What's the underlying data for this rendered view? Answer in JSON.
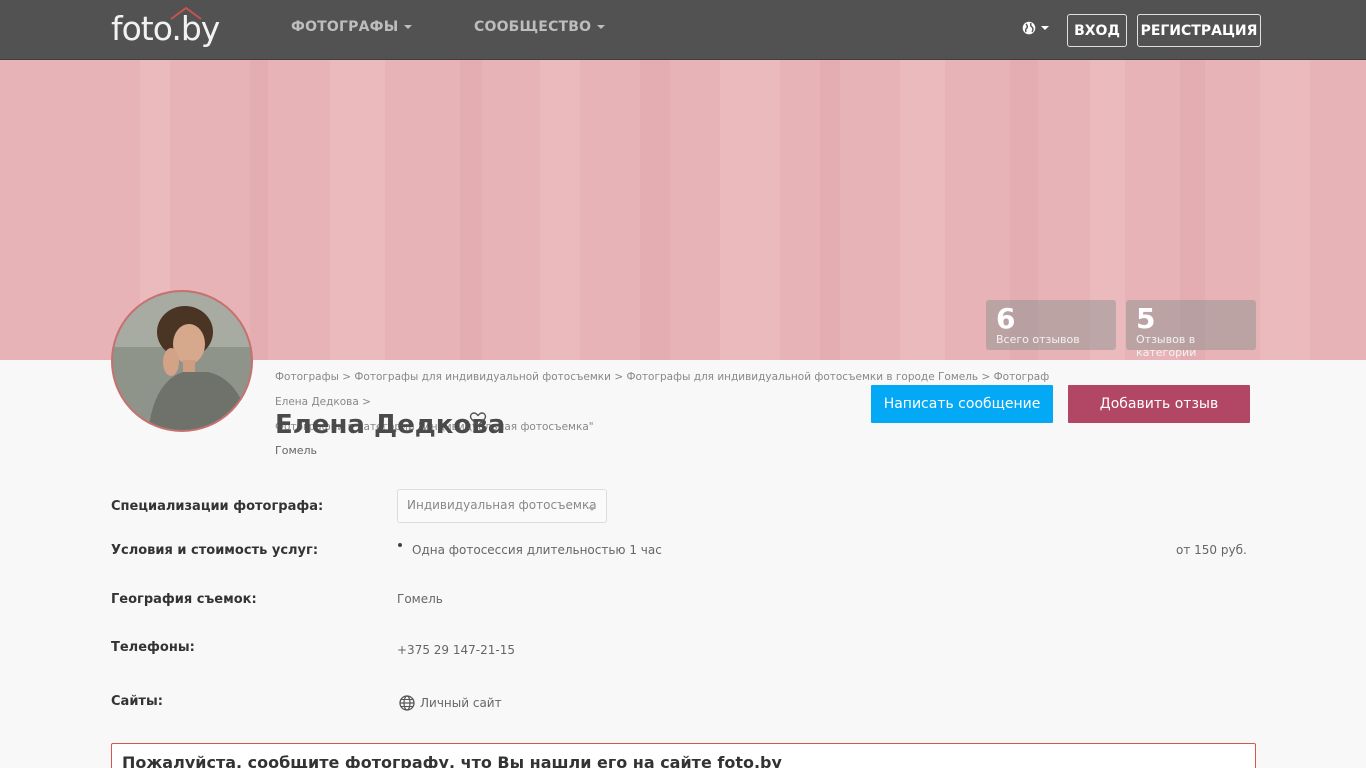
{
  "header": {
    "logo": "foto.by",
    "nav": [
      {
        "label": "ФОТОГРАФЫ"
      },
      {
        "label": "СООБЩЕСТВО"
      }
    ],
    "language_icon": "globe-icon",
    "login_label": "ВХОД",
    "register_label": "РЕГИСТРАЦИЯ"
  },
  "stats": [
    {
      "value": "6",
      "label": "Всего отзывов"
    },
    {
      "value": "5",
      "label": "Отзывов в категории"
    }
  ],
  "breadcrumbs": [
    "Фотографы",
    "Фотографы для индивидуальной фотосъемки",
    "Фотографы для индивидуальной фотосъемки в городе Гомель",
    "Фотограф Елена Дедкова",
    "Фотографии в категории \"Индивидуальная фотосъемка\""
  ],
  "breadcrumb_separator": ">",
  "profile": {
    "name": "Елена Дедкова",
    "city": "Гомель"
  },
  "actions": {
    "message_label": "Написать сообщение",
    "review_label": "Добавить отзыв"
  },
  "info": {
    "specializations_label": "Специализации фотографа:",
    "specialization_selected": "Индивидуальная фотосъемка",
    "services_label": "Условия и стоимость услуг:",
    "service_name": "Одна фотосессия длительностью 1 час",
    "service_price": "от 150 руб.",
    "geography_label": "География съемок:",
    "geography_value": "Гомель",
    "phones_label": "Телефоны:",
    "phone_value": "+375 29 147-21-15",
    "sites_label": "Сайты:",
    "site_value": "Личный сайт"
  },
  "notice": "Пожалуйста, сообщите фотографу, что Вы нашли его на сайте foto.by",
  "colors": {
    "topbar": "#525252",
    "cover": "#e8b3b6",
    "message_button": "#03a9f4",
    "review_button": "#b14764",
    "notice_border": "#d9534f"
  }
}
